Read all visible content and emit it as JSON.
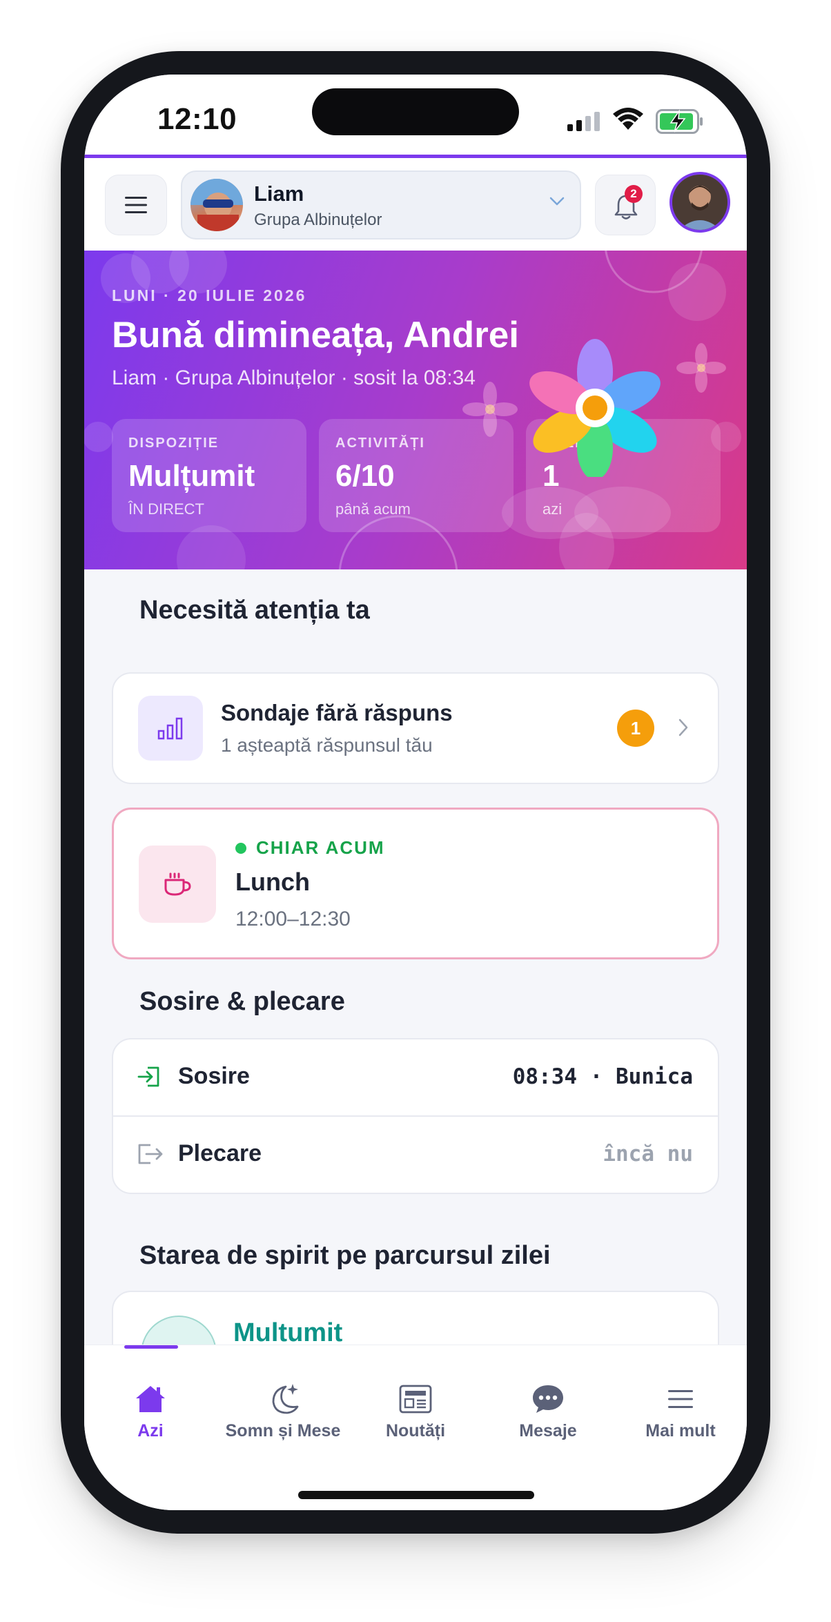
{
  "status_bar": {
    "time": "12:10"
  },
  "header": {
    "child_name": "Liam",
    "child_group": "Grupa Albinuțelor",
    "notification_count": "2"
  },
  "hero": {
    "date": "LUNI · 20 IULIE 2026",
    "greeting": "Bună dimineața, Andrei",
    "subtitle": "Liam · Grupa Albinuțelor · sosit la 08:34",
    "stats": [
      {
        "label": "DISPOZIȚIE",
        "value": "Mulțumit",
        "foot": "ÎN DIRECT"
      },
      {
        "label": "ACTIVITĂȚI",
        "value": "6/10",
        "foot": "până acum"
      },
      {
        "label": "POZE",
        "value": "1",
        "foot": "azi"
      }
    ]
  },
  "attention": {
    "title": "Necesită atenția ta",
    "poll": {
      "title": "Sondaje fără răspuns",
      "subtitle": "1 așteaptă răspunsul tău",
      "count": "1"
    }
  },
  "now": {
    "tag": "CHIAR ACUM",
    "title": "Lunch",
    "time": "12:00–12:30"
  },
  "arrival": {
    "title": "Sosire & plecare",
    "rows": [
      {
        "label": "Sosire",
        "value": "08:34 · Bunica"
      },
      {
        "label": "Plecare",
        "value": "încă nu"
      }
    ]
  },
  "mood": {
    "title": "Starea de spirit pe parcursul zilei",
    "current": "Multumit"
  },
  "tabbar": {
    "tabs": [
      {
        "label": "Azi",
        "icon": "home-icon"
      },
      {
        "label": "Somn și Mese",
        "icon": "moon-stars-icon"
      },
      {
        "label": "Noutăți",
        "icon": "newspaper-icon"
      },
      {
        "label": "Mesaje",
        "icon": "chat-bubble-icon"
      },
      {
        "label": "Mai mult",
        "icon": "menu-icon"
      }
    ],
    "active_index": 0
  },
  "colors": {
    "accent": "#7c3aed",
    "hero_gradient_start": "#7c3aed",
    "hero_gradient_end": "#d93a88",
    "now_green": "#16a34a",
    "badge_orange": "#f59e0b",
    "mood_teal": "#0d9488"
  }
}
